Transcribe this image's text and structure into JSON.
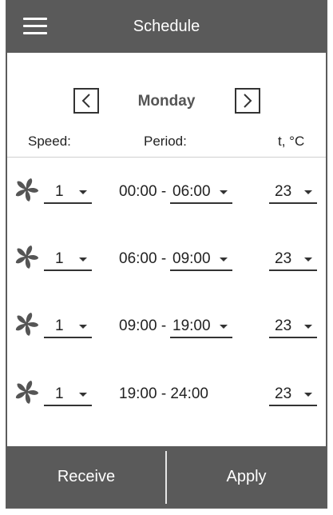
{
  "header": {
    "title": "Schedule",
    "menu_icon": "menu-icon"
  },
  "day_nav": {
    "day": "Monday",
    "prev_icon": "chevron-left-icon",
    "next_icon": "chevron-right-icon"
  },
  "columns": {
    "speed": "Speed:",
    "period": "Period:",
    "temp": "t, °C"
  },
  "rows": [
    {
      "speed": "1",
      "from": "00:00 -",
      "to": "06:00",
      "temp": "23"
    },
    {
      "speed": "1",
      "from": "06:00 -",
      "to": "09:00",
      "temp": "23"
    },
    {
      "speed": "1",
      "from": "09:00 -",
      "to": "19:00",
      "temp": "23"
    },
    {
      "speed": "1",
      "period": "19:00 - 24:00",
      "temp": "23"
    }
  ],
  "actions": {
    "receive": "Receive",
    "apply": "Apply"
  },
  "colors": {
    "bar": "#5a5a5a",
    "text": "#333333",
    "background": "#ffffff"
  }
}
